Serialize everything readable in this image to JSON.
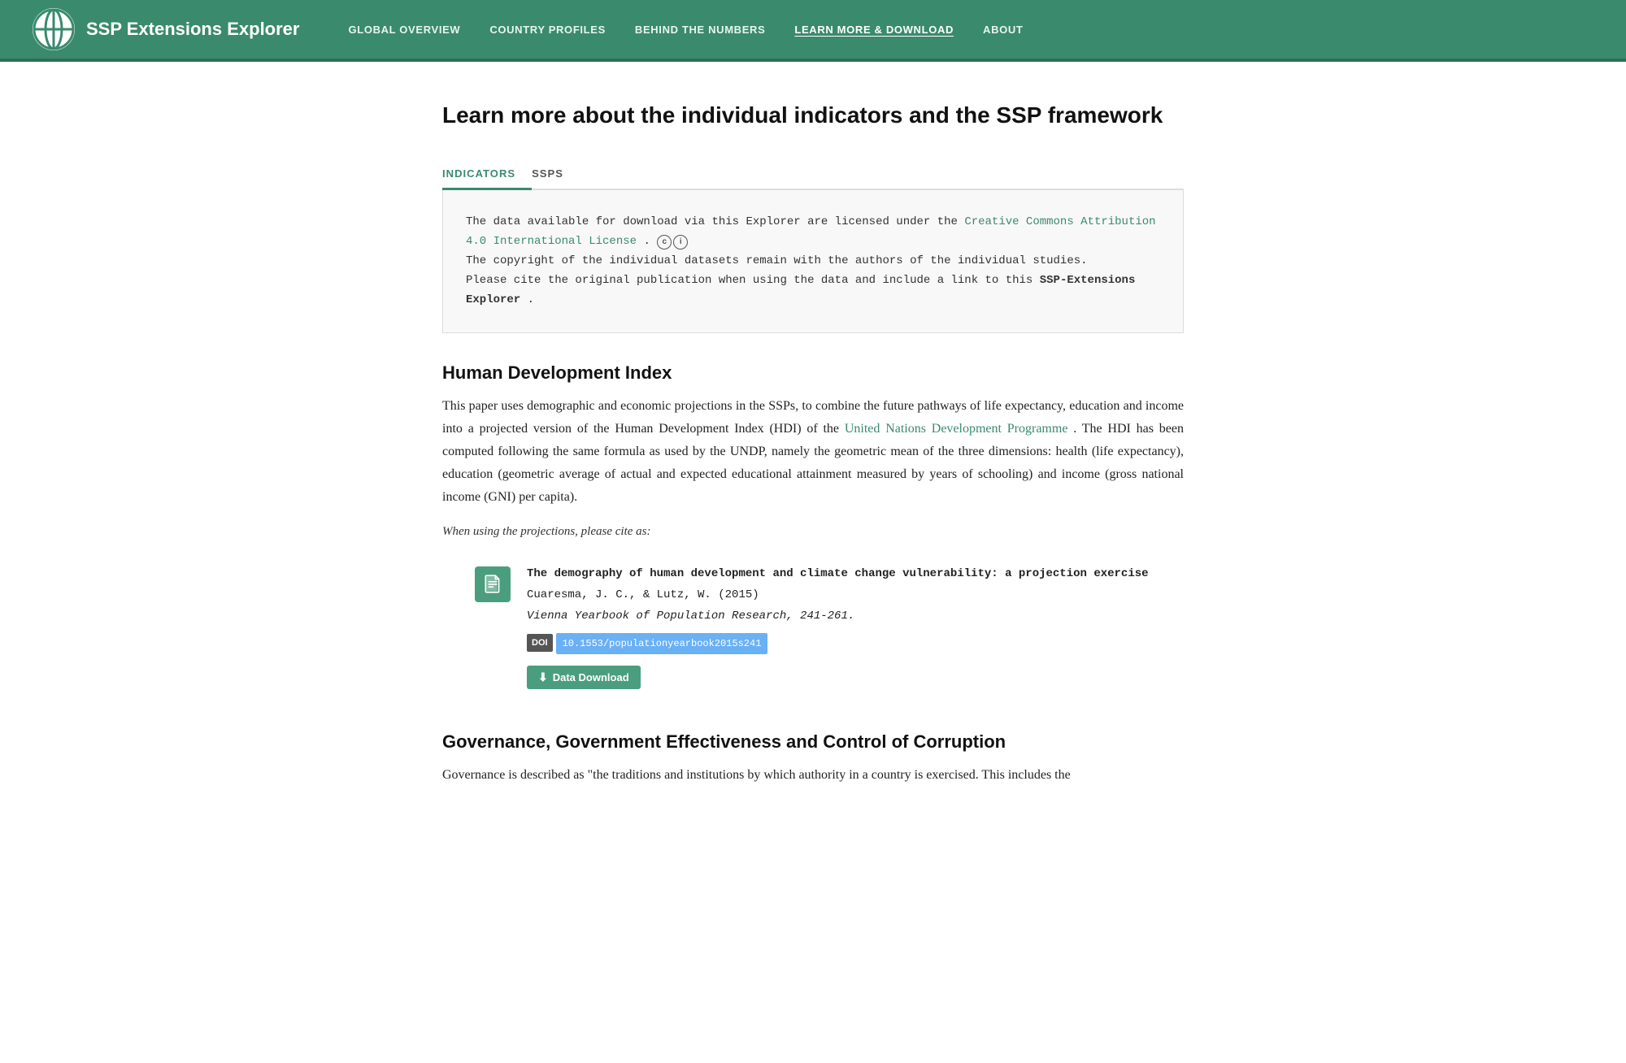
{
  "header": {
    "app_title": "SSP Extensions Explorer",
    "nav_items": [
      {
        "id": "global-overview",
        "label": "Global Overview",
        "active": false
      },
      {
        "id": "country-profiles",
        "label": "Country Profiles",
        "active": false
      },
      {
        "id": "behind-the-numbers",
        "label": "Behind the Numbers",
        "active": false
      },
      {
        "id": "learn-more-download",
        "label": "Learn More & Download",
        "active": true
      },
      {
        "id": "about",
        "label": "About",
        "active": false
      }
    ]
  },
  "page": {
    "title": "Learn more about the individual indicators and the SSP framework"
  },
  "tabs": [
    {
      "id": "indicators",
      "label": "Indicators",
      "active": true
    },
    {
      "id": "ssps",
      "label": "SSPs",
      "active": false
    }
  ],
  "license_block": {
    "prefix": "The data available for download via this Explorer are licensed under the",
    "link_text": "Creative Commons Attribution 4.0 International License",
    "link_url": "#",
    "suffix": ".",
    "line2": "The copyright of the individual datasets remain with the authors of the individual studies.",
    "line3": "Please cite the original publication when using the data and include a link to this",
    "line3_bold": "SSP-Extensions Explorer",
    "line3_end": "."
  },
  "sections": [
    {
      "id": "hdi",
      "heading": "Human Development Index",
      "paragraphs": [
        "This paper uses demographic and economic projections in the SSPs, to combine the future pathways of life expectancy, education and income into a projected version of the Human Development Index (HDI) of the",
        "United Nations Development Programme",
        ". The HDI has been computed following the same formula as used by the UNDP, namely the geometric mean of the three dimensions: health (life expectancy), education (geometric average of actual and expected educational attainment measured by years of schooling) and income (gross national income (GNI) per capita)."
      ],
      "undp_link": "United Nations Development Programme",
      "cite_label": "When using the projections, please cite as:",
      "citation": {
        "title": "The demography of human development and climate change vulnerability: a projection exercise",
        "authors": "Cuaresma, J. C., & Lutz, W. (2015)",
        "journal": "Vienna Yearbook of Population Research, 241-261.",
        "doi_label": "DOI",
        "doi_value": "10.1553/populationyearbook2015s241",
        "doi_url": "#",
        "download_label": "Data Download"
      }
    },
    {
      "id": "governance",
      "heading": "Governance, Government Effectiveness and Control of Corruption",
      "paragraphs": [
        "Governance is described as \"the traditions and institutions by which authority in a country is exercised. This includes the"
      ]
    }
  ]
}
